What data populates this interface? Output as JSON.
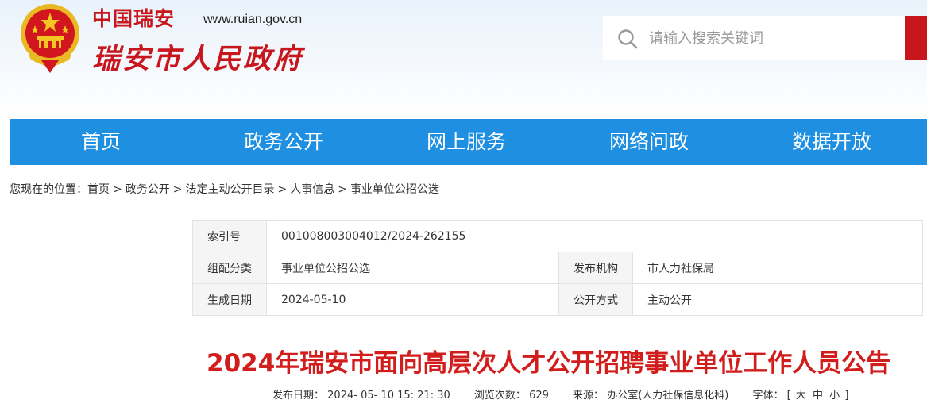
{
  "header": {
    "logo_small": "中国瑞安",
    "logo_url": "www.ruian.gov.cn",
    "logo_big": "瑞安市人民政府",
    "emblem_icon": "national-emblem-icon",
    "search": {
      "placeholder": "请输入搜索关键词",
      "value": ""
    },
    "colors": {
      "brand_red": "#c8161d",
      "nav_blue": "#1e8fe1"
    }
  },
  "nav": {
    "items": [
      {
        "label": "首页"
      },
      {
        "label": "政务公开"
      },
      {
        "label": "网上服务"
      },
      {
        "label": "网络问政"
      },
      {
        "label": "数据开放"
      }
    ]
  },
  "breadcrumb": {
    "prefix": "您现在的位置：",
    "items": [
      "首页",
      "政务公开",
      "法定主动公开目录",
      "人事信息",
      "事业单位公招公选"
    ],
    "separator": ">"
  },
  "meta": {
    "index_label": "索引号",
    "index_value": "001008003004012/2024-262155",
    "category_label": "组配分类",
    "category_value": "事业单位公招公选",
    "publisher_label": "发布机构",
    "publisher_value": "市人力社保局",
    "date_label": "生成日期",
    "date_value": "2024-05-10",
    "mode_label": "公开方式",
    "mode_value": "主动公开"
  },
  "article": {
    "title": "2024年瑞安市面向高层次人才公开招聘事业单位工作人员公告",
    "publish_label": "发布日期：",
    "publish_value": "2024- 05- 10 15: 21: 30",
    "views_label": "浏览次数：",
    "views_value": "629",
    "source_label": "来源：",
    "source_value": "办公室(人力社保信息化科)",
    "font_label": "字体：",
    "font_open": "[",
    "font_large": "大",
    "font_medium": "中",
    "font_small": "小",
    "font_close": "]"
  }
}
